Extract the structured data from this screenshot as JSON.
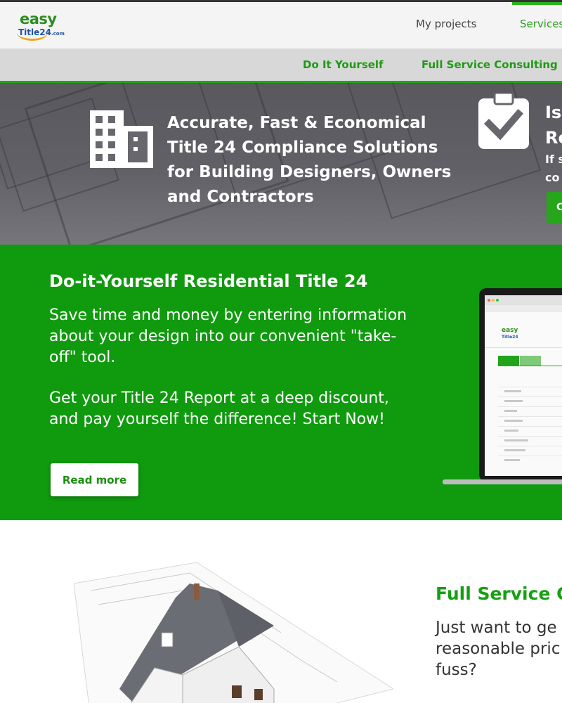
{
  "header": {
    "logo": {
      "line1": "easy",
      "line2": "Title24",
      "line2_suffix": ".com"
    },
    "nav": [
      {
        "label": "My projects"
      },
      {
        "label": "Services"
      }
    ]
  },
  "subnav": {
    "items": [
      {
        "label": "Do It Yourself"
      },
      {
        "label": "Full Service Consulting"
      }
    ]
  },
  "hero": {
    "left_text": "Accurate, Fast & Economical Title 24 Compliance Solutions for Building Designers, Owners and Contractors",
    "right_heading_line1": "Is",
    "right_heading_line2": "Re",
    "right_sub_line1": "If s",
    "right_sub_line2": "co",
    "right_button": "C"
  },
  "diy": {
    "title": "Do-it-Yourself Residential Title 24",
    "para1": "Save time and money by entering information about your design into our convenient \"take-off\" tool.",
    "para2": "Get your Title 24 Report at a deep discount, and pay yourself the difference! Start Now!",
    "button": "Read more"
  },
  "full_service": {
    "title": "Full Service C",
    "body_line1": "Just want to ge",
    "body_line2": "reasonable pric",
    "body_line3": "fuss?"
  },
  "colors": {
    "brand_green": "#109a0e",
    "accent_green": "#22a41a",
    "logo_blue": "#1e55a8",
    "logo_orange": "#f2a31a"
  }
}
